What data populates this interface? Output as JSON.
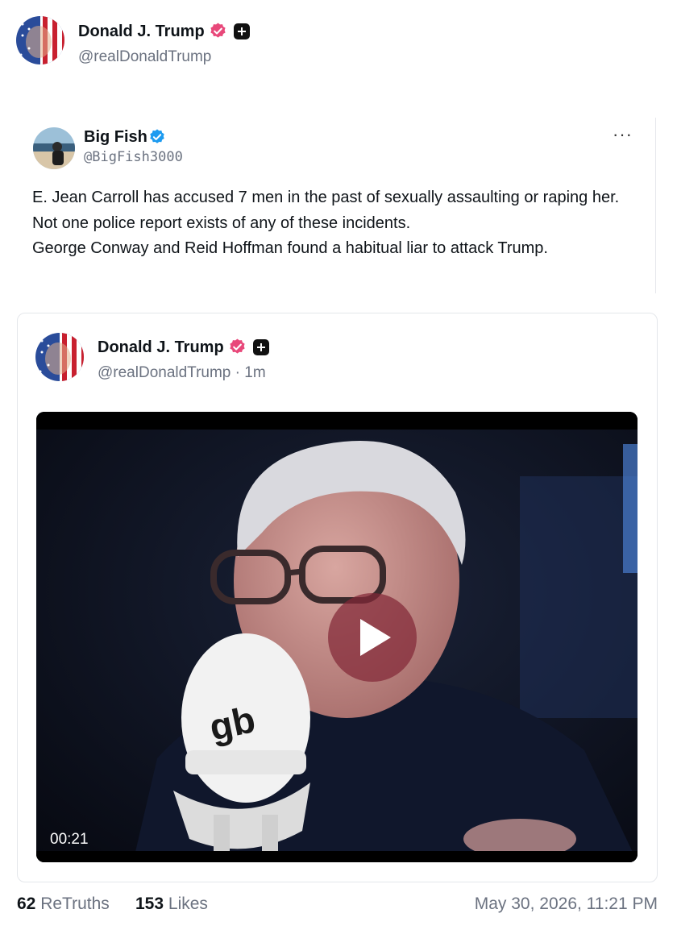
{
  "post": {
    "author_name": "Donald J. Trump",
    "author_handle": "@realDonaldTrump"
  },
  "embedded_tweet": {
    "author_name": "Big Fish",
    "author_handle": "@BigFish3000",
    "more_label": "···",
    "text_lines": [
      "E. Jean Carroll has accused 7 men in the past of sexually assaulting or raping her.",
      "Not one police report exists of any of these incidents.",
      "George Conway and Reid Hoffman found a habitual liar to attack Trump."
    ]
  },
  "quoted_post": {
    "author_name": "Donald J. Trump",
    "author_handle": "@realDonaldTrump · 1m",
    "video": {
      "duration": "00:21",
      "mic_logo_text": "gb"
    }
  },
  "stats": {
    "retruths_count": "62",
    "retruths_label": "ReTruths",
    "likes_count": "153",
    "likes_label": "Likes",
    "timestamp": "May 30, 2026, 11:21 PM"
  },
  "colors": {
    "verified_pink": "#e8487a",
    "verified_blue": "#1d9bf0",
    "text_primary": "#0f1419",
    "text_secondary": "#6b7280"
  },
  "icons": {
    "verified_badge": "verified-badge-icon",
    "plus_badge": "plus-badge-icon",
    "play": "play-icon",
    "more": "more-dots-icon"
  }
}
